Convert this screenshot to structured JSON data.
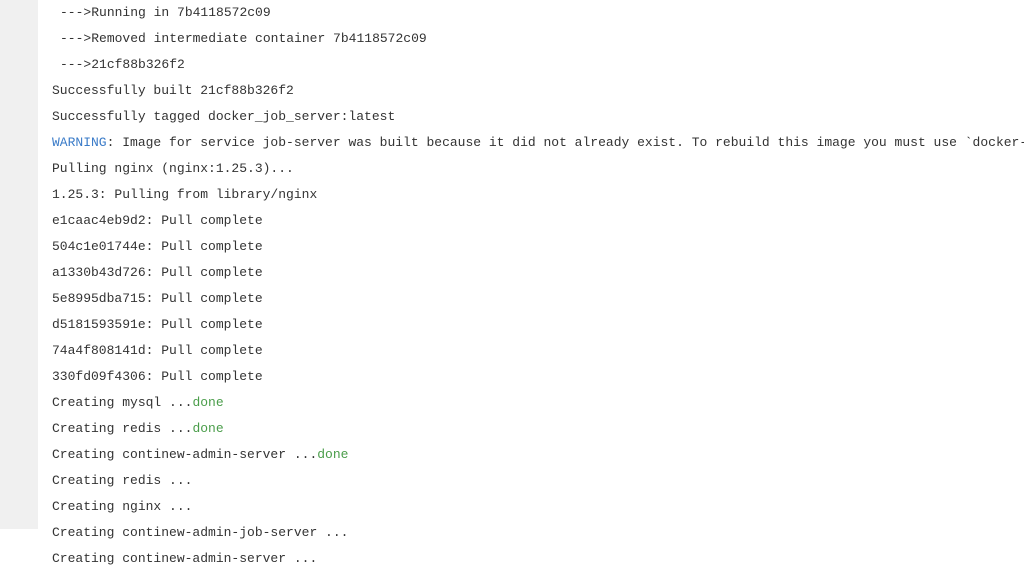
{
  "lines": [
    {
      "prefix": " ---> ",
      "text": "Running in 7b4118572c09"
    },
    {
      "prefix": " ---> ",
      "text": "Removed intermediate container 7b4118572c09"
    },
    {
      "prefix": " ---> ",
      "text": "21cf88b326f2"
    }
  ],
  "built": "Successfully built 21cf88b326f2",
  "tagged": "Successfully tagged docker_job_server:latest",
  "warning_label": "WARNING",
  "warning_text": ": Image for service job-server was built because it did not already exist. To rebuild this image you must use `docker-compose build` or `",
  "pulling_nginx": "Pulling nginx (nginx:1.25.3)...",
  "pulling_from": "1.25.3: Pulling from library/nginx",
  "pulls": [
    "e1caac4eb9d2: Pull complete",
    "504c1e01744e: Pull complete",
    "a1330b43d726: Pull complete",
    "5e8995dba715: Pull complete",
    "d5181593591e: Pull complete",
    "74a4f808141d: Pull complete",
    "330fd09f4306: Pull complete"
  ],
  "creating_done": [
    {
      "name": "Creating mysql ... ",
      "status": "done"
    },
    {
      "name": "Creating redis ... ",
      "status": "done"
    },
    {
      "name": "Creating continew-admin-server ... ",
      "status": "done"
    }
  ],
  "creating": [
    "Creating redis ...",
    "Creating nginx ...",
    "Creating continew-admin-job-server ...",
    "Creating continew-admin-server ..."
  ]
}
